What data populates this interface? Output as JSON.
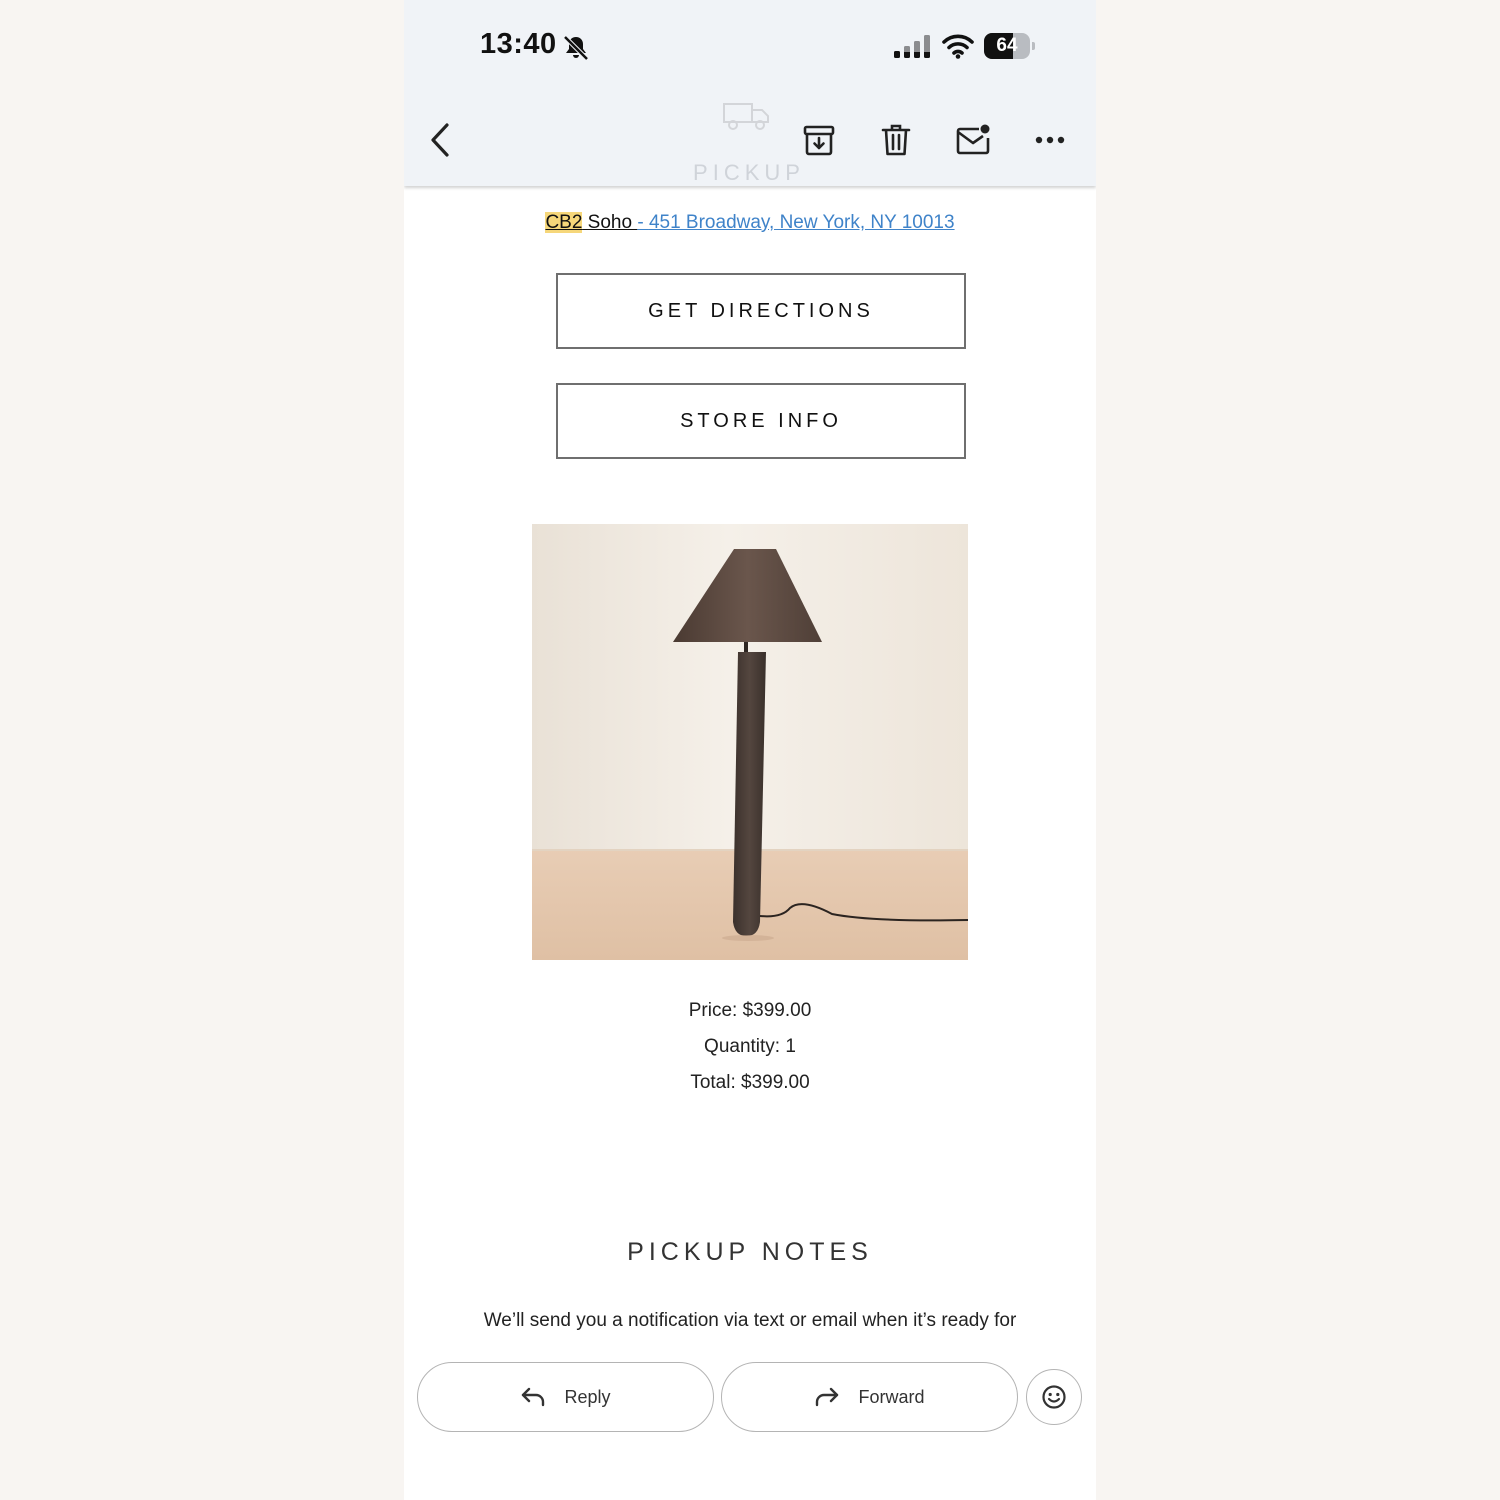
{
  "status_bar": {
    "time": "13:40",
    "battery_level": "64",
    "icons": [
      "bell-slash-icon",
      "cellular-signal-icon",
      "wifi-icon",
      "battery-icon"
    ]
  },
  "toolbar": {
    "faint_header_text": "PICKUP",
    "icons": [
      "back-chevron-icon",
      "archive-icon",
      "trash-icon",
      "mark-unread-icon",
      "more-icon"
    ]
  },
  "pickup_location": {
    "store_brand": "CB2",
    "store_name": " Soho ",
    "separator": "- ",
    "address": "451 Broadway, New York, NY 10013"
  },
  "buttons": {
    "get_directions": "GET DIRECTIONS",
    "store_info": "STORE INFO"
  },
  "product": {
    "price": "Price: $399.00",
    "quantity": "Quantity: 1",
    "total": "Total: $399.00"
  },
  "pickup_notes": {
    "heading": "PICKUP NOTES",
    "text": "We’ll send you a notification via text or email when it’s ready for"
  },
  "actions": {
    "reply": "Reply",
    "forward": "Forward",
    "emoji_icon": "smiley-icon"
  },
  "colors": {
    "chrome_bg": "#f0f3f7",
    "link": "#3f83c9",
    "highlight": "#f6d77a",
    "page_bg": "#f8f5f2"
  }
}
